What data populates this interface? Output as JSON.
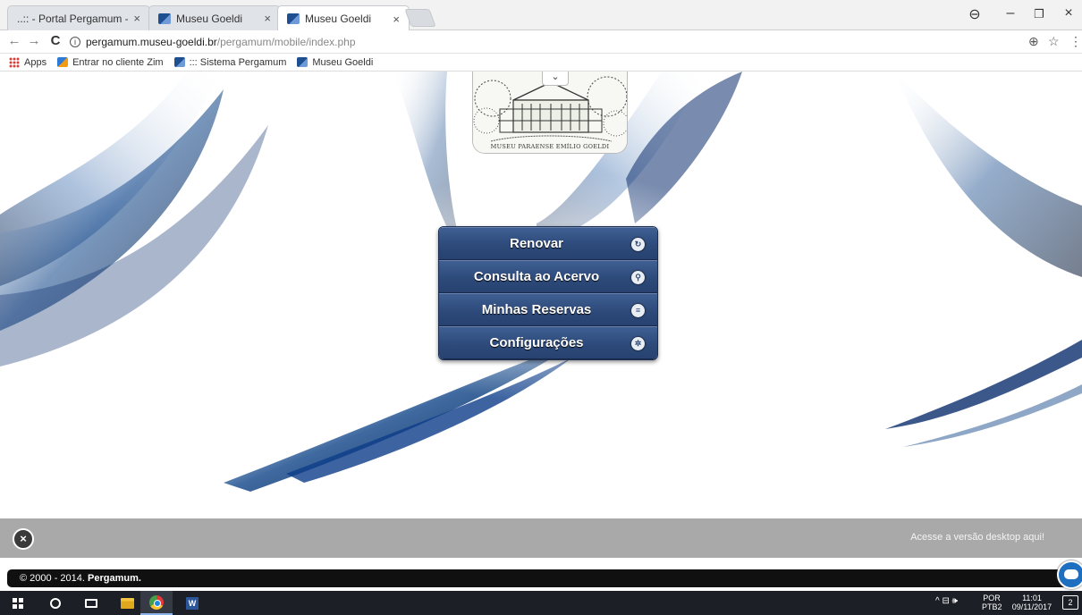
{
  "browser": {
    "tabs": [
      {
        "label": "..:: - Portal Pergamum - ::",
        "icon": "page-icon",
        "active": false
      },
      {
        "label": "Museu Goeldi",
        "icon": "museum-favicon",
        "active": false
      },
      {
        "label": "Museu Goeldi",
        "icon": "museum-favicon",
        "active": true
      }
    ],
    "tab_close": "×",
    "window_controls": {
      "account": "⊖",
      "minimize": "–",
      "restore": "❐",
      "close": "×"
    },
    "nav": {
      "back": "←",
      "forward": "→",
      "reload": "C"
    },
    "url": {
      "domain": "pergamum.museu-goeldi.br",
      "path": "/pergamum/mobile/index.php",
      "info": "i"
    },
    "zoom_icon": "⊕",
    "star_icon": "☆",
    "menu_icon": "⋮",
    "bookmarks": [
      {
        "label": "Apps",
        "icon": "apps-icon"
      },
      {
        "label": "Entrar no cliente Zim",
        "icon": "zimbra-icon"
      },
      {
        "label": "::: Sistema Pergamum",
        "icon": "museum-favicon"
      },
      {
        "label": "Museu Goeldi",
        "icon": "museum-favicon"
      }
    ]
  },
  "page": {
    "logo_caption": "MUSEU PARAENSE EMÍLIO GOELDI",
    "logo_toggle": "⌄",
    "menu": [
      {
        "label": "Renovar",
        "icon": "refresh-icon",
        "glyph": "↻"
      },
      {
        "label": "Consulta ao Acervo",
        "icon": "search-icon",
        "glyph": "⚲"
      },
      {
        "label": "Minhas Reservas",
        "icon": "list-icon",
        "glyph": "≡"
      },
      {
        "label": "Configurações",
        "icon": "gear-icon",
        "glyph": "✲"
      }
    ],
    "close_glyph": "×",
    "desktop_link": "Acesse a versão desktop aqui!",
    "footer_prefix": "© 2000 - 2014.",
    "footer_brand": "Pergamum."
  },
  "taskbar": {
    "lang_top": "POR",
    "lang_bottom": "PTB2",
    "time": "11:01",
    "date": "09/11/2017",
    "notification_count": "2",
    "tray_icons": "^  ⊟  🕪"
  },
  "colors": {
    "menu_bg": "#2d4a7a",
    "bottombar": "#a9a9a9",
    "footer": "#101010",
    "swoosh": "#0b2e6e"
  }
}
